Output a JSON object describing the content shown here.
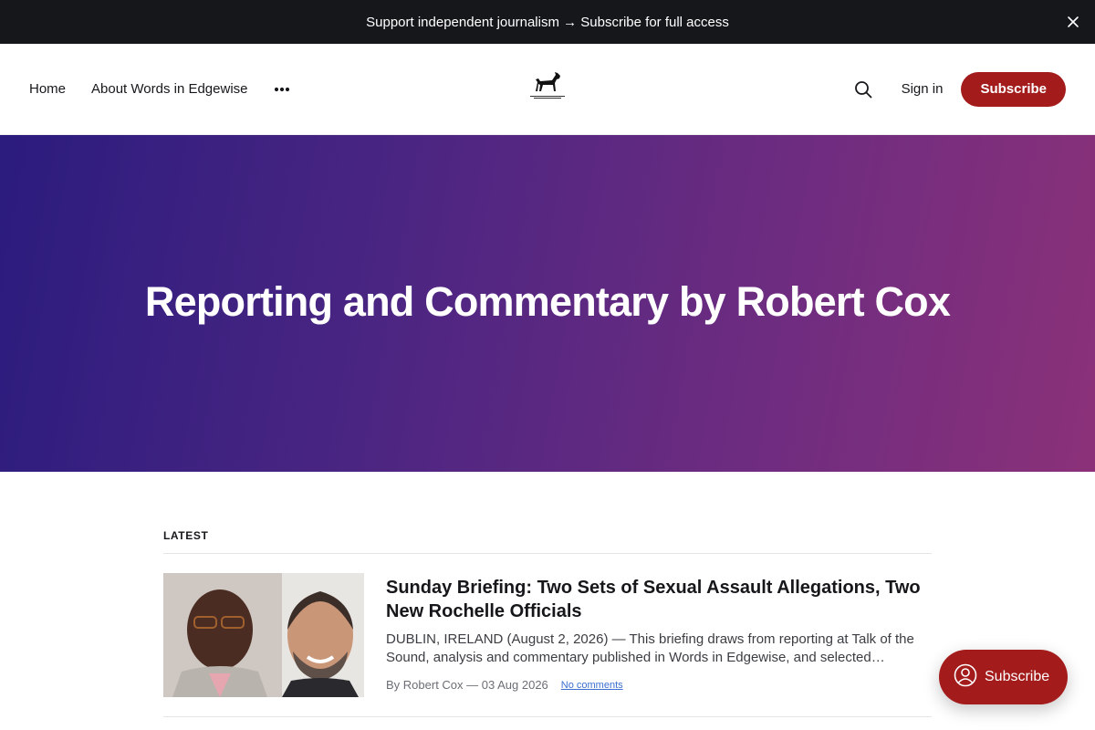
{
  "announcement": {
    "text": "Support independent journalism → Subscribe for full access",
    "close_icon": "close-icon"
  },
  "header": {
    "nav": [
      {
        "label": "Home"
      },
      {
        "label": "About Words in Edgewise"
      }
    ],
    "more_icon": "ellipsis-icon",
    "logo_icon": "dog-logo-icon",
    "search_icon": "search-icon",
    "signin_label": "Sign in",
    "subscribe_label": "Subscribe"
  },
  "hero": {
    "title": "Reporting and Commentary by Robert Cox"
  },
  "feed": {
    "label": "LATEST",
    "posts": [
      {
        "title": "Sunday Briefing: Two Sets of Sexual Assault Allegations, Two New Rochelle Officials",
        "excerpt": "DUBLIN, IRELAND (August 2, 2026) — This briefing draws from reporting at Talk of the Sound, analysis and commentary published in Words in Edgewise, and selected…",
        "meta": "By Robert Cox — 03 Aug 2026",
        "comments": "No comments"
      }
    ]
  },
  "portal": {
    "label": "Subscribe",
    "icon": "user-circle-icon"
  },
  "colors": {
    "accent": "#a31b1b",
    "announcement_bg": "#15171a",
    "hero_start": "#2b1c7e",
    "hero_end": "#8b3179",
    "link": "#3b6fd1"
  }
}
